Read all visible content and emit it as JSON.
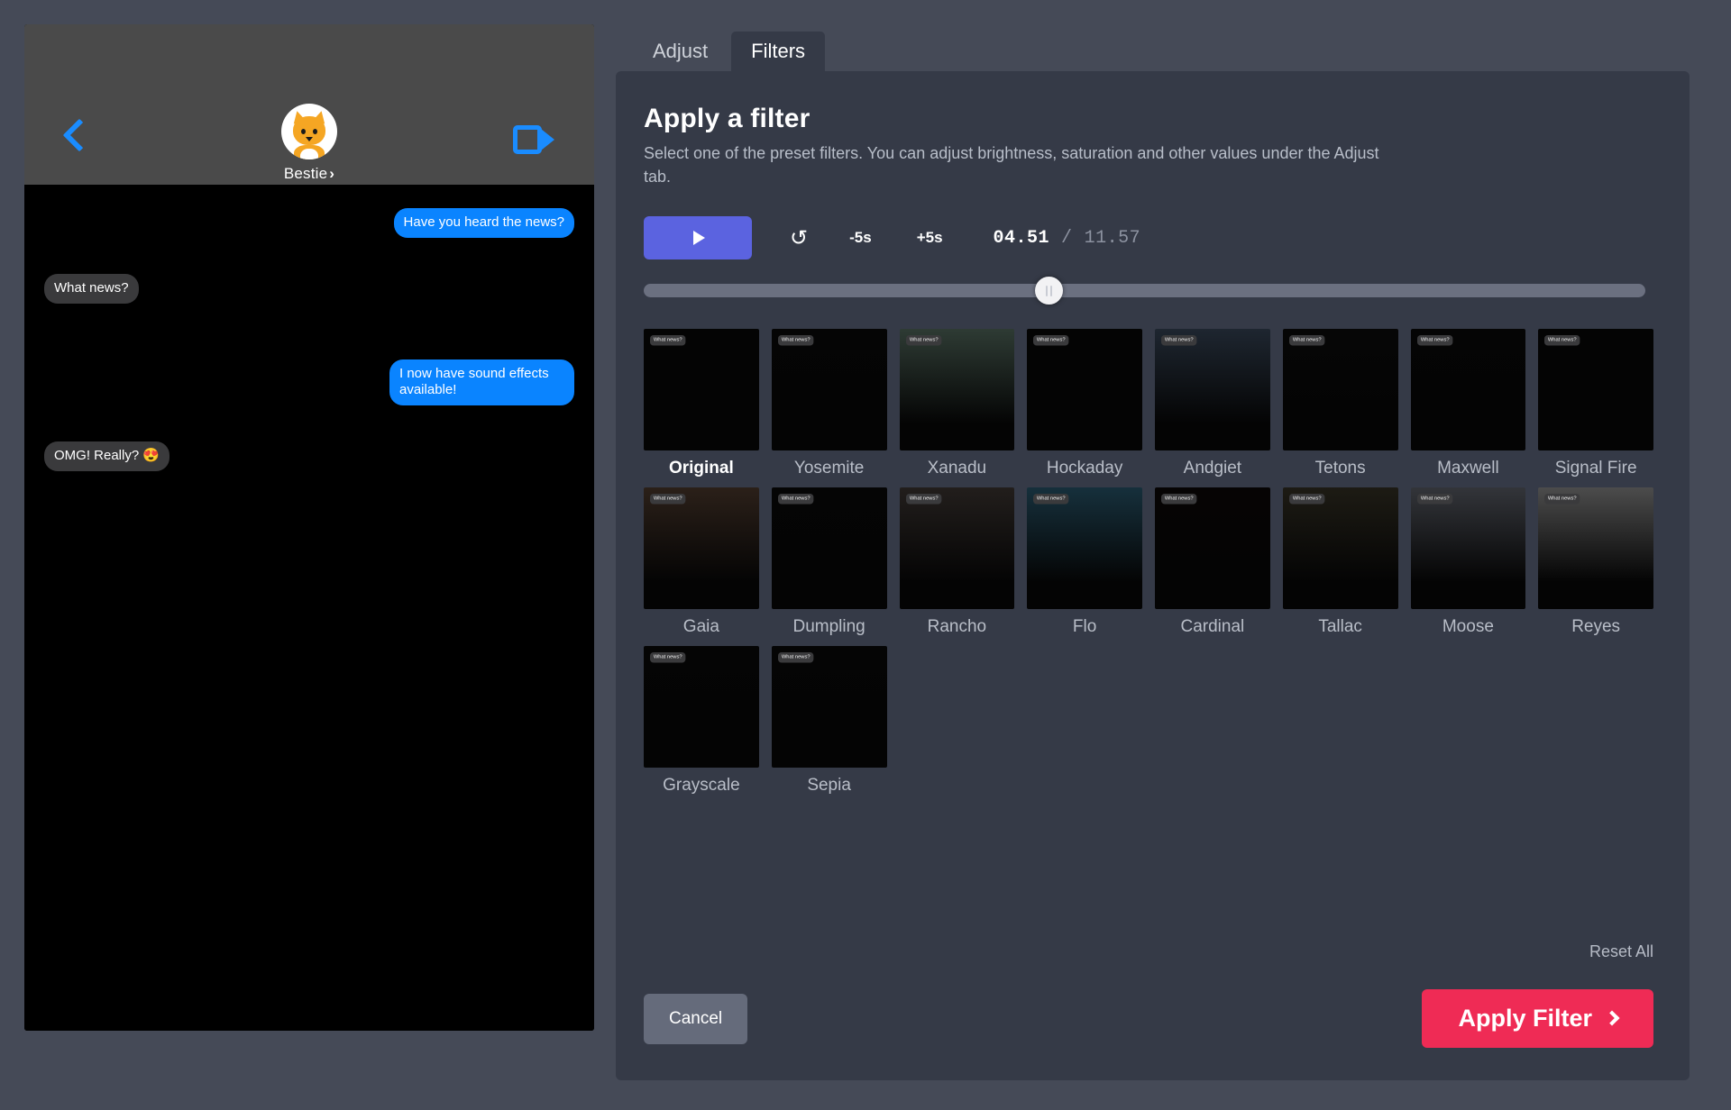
{
  "preview": {
    "back_icon": "back-chevron-icon",
    "video_icon": "video-camera-icon",
    "contact_name": "Bestie",
    "contact_chevron": "›",
    "avatar_alt": "cat-avatar",
    "messages": [
      {
        "side": "out",
        "text": "Have you heard the news?"
      },
      {
        "side": "in",
        "text": "What news?"
      },
      {
        "side": "out",
        "text": "I now have sound effects available!"
      },
      {
        "side": "in",
        "text": "OMG! Really? 😍"
      }
    ]
  },
  "tabs": [
    {
      "label": "Adjust",
      "active": false
    },
    {
      "label": "Filters",
      "active": true
    }
  ],
  "panel": {
    "title": "Apply a filter",
    "description": "Select one of the preset filters. You can adjust brightness, saturation and other values under the Adjust tab."
  },
  "transport": {
    "play_label": "▶",
    "restart_label": "↺",
    "back5_label": "-5s",
    "forward5_label": "+5s",
    "current_time": "04.51",
    "separator": "/",
    "total_time": "11.57",
    "progress_percent": 39.1
  },
  "filters": {
    "selected": "Original",
    "thumb_caption": "What news?",
    "items": [
      {
        "label": "Original",
        "bg": "#040404",
        "selected": true
      },
      {
        "label": "Yosemite",
        "bg": "#050505",
        "selected": false
      },
      {
        "label": "Xanadu",
        "bg": "#2e3b34",
        "selected": false
      },
      {
        "label": "Hockaday",
        "bg": "#040404",
        "selected": false
      },
      {
        "label": "Andgiet",
        "bg": "#1e2630",
        "selected": false
      },
      {
        "label": "Tetons",
        "bg": "#060606",
        "selected": false
      },
      {
        "label": "Maxwell",
        "bg": "#050505",
        "selected": false
      },
      {
        "label": "Signal Fire",
        "bg": "#040404",
        "selected": false
      },
      {
        "label": "Gaia",
        "bg": "#2b2019",
        "selected": false
      },
      {
        "label": "Dumpling",
        "bg": "#050505",
        "selected": false
      },
      {
        "label": "Rancho",
        "bg": "#221e1c",
        "selected": false
      },
      {
        "label": "Flo",
        "bg": "#16303c",
        "selected": false
      },
      {
        "label": "Cardinal",
        "bg": "#060404",
        "selected": false
      },
      {
        "label": "Tallac",
        "bg": "#1d1b14",
        "selected": false
      },
      {
        "label": "Moose",
        "bg": "#33353a",
        "selected": false
      },
      {
        "label": "Reyes",
        "bg": "#4c4c4c",
        "selected": false
      },
      {
        "label": "Grayscale",
        "bg": "#050505",
        "selected": false
      },
      {
        "label": "Sepia",
        "bg": "#050505",
        "selected": false
      }
    ]
  },
  "footer": {
    "reset_all": "Reset All",
    "cancel": "Cancel",
    "apply": "Apply Filter"
  },
  "colors": {
    "app_bg": "#454a57",
    "panel_bg": "#353a47",
    "accent_play": "#5b63e0",
    "accent_apply": "#ef2b55",
    "bubble_out": "#0a84ff",
    "bubble_in": "#3a3a3c",
    "link_blue": "#1a8cff"
  }
}
